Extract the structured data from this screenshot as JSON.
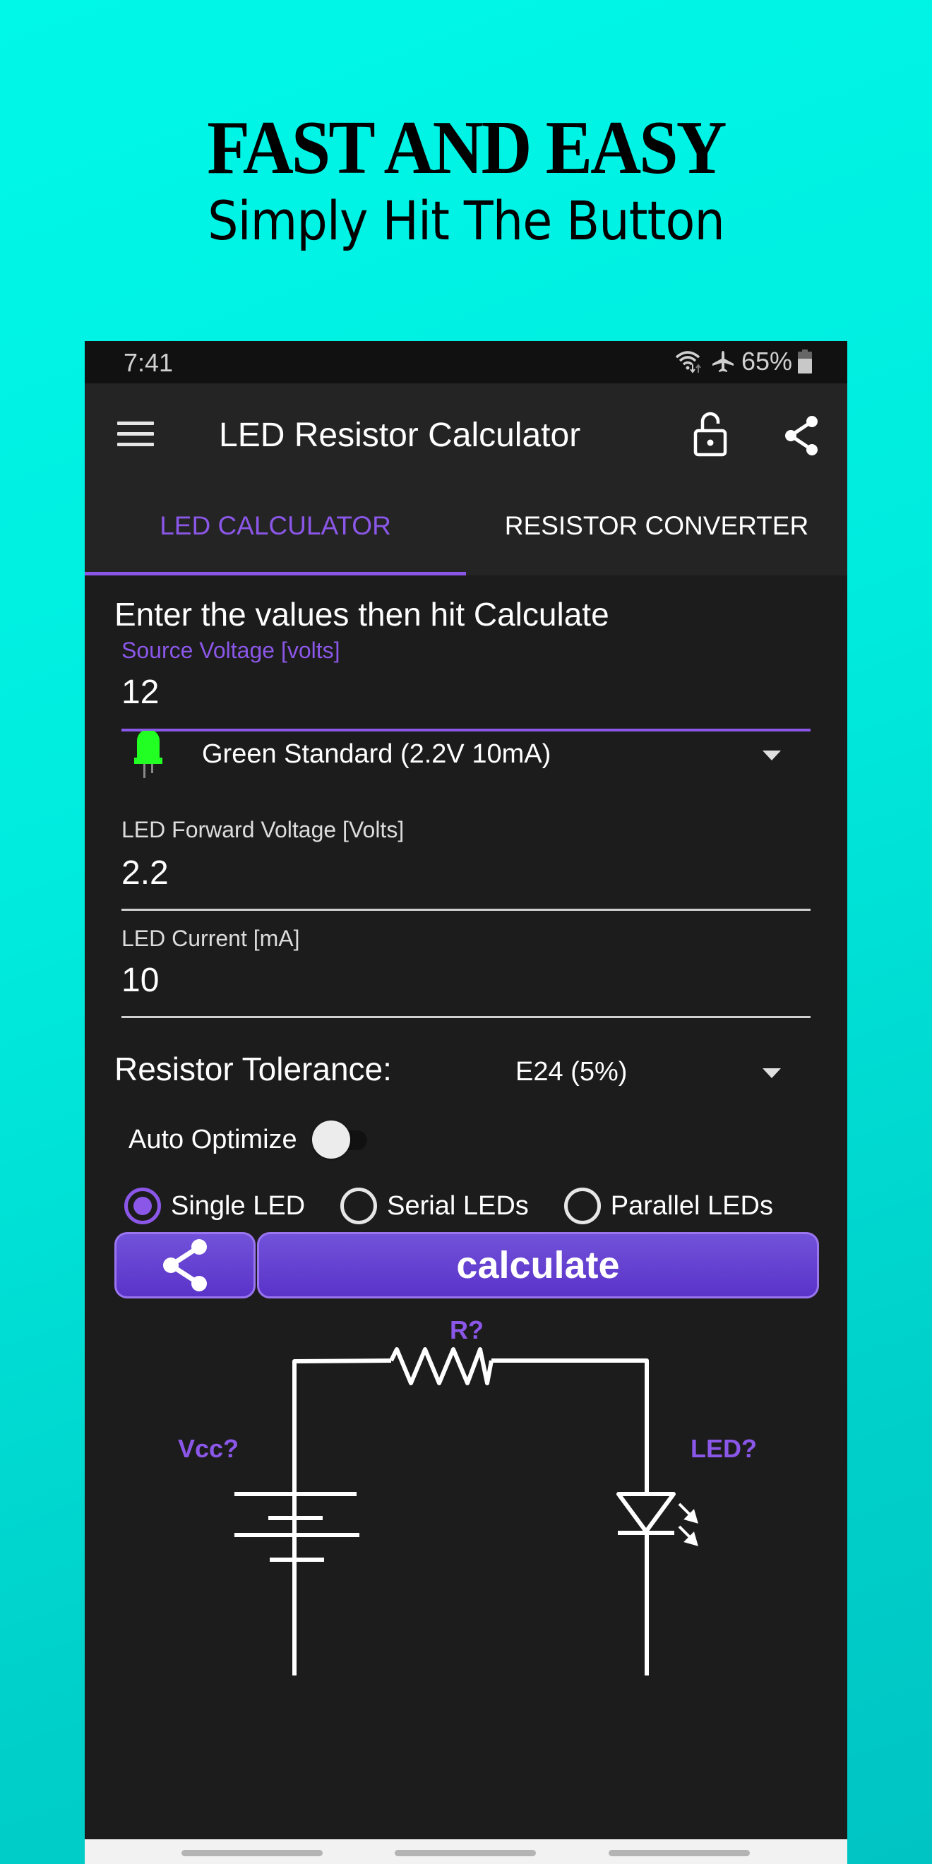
{
  "promo": {
    "title": "FAST AND EASY",
    "subtitle": "Simply Hit The Button"
  },
  "status_bar": {
    "time": "7:41",
    "battery_percent": "65%",
    "icons": [
      "wifi-icon",
      "airplane-icon",
      "battery-icon"
    ]
  },
  "toolbar": {
    "title": "LED Resistor Calculator",
    "icons": [
      "menu-icon",
      "lock-open-icon",
      "share-icon"
    ]
  },
  "tabs": [
    {
      "label": "LED CALCULATOR",
      "active": true
    },
    {
      "label": "RESISTOR CONVERTER",
      "active": false
    }
  ],
  "form": {
    "instructions": "Enter the values then hit Calculate",
    "source_voltage": {
      "label": "Source Voltage [volts]",
      "value": "12"
    },
    "led_type": {
      "selected": "Green Standard (2.2V 10mA)",
      "led_color": "#22ff22"
    },
    "forward_voltage": {
      "label": "LED Forward Voltage [Volts]",
      "value": "2.2"
    },
    "led_current": {
      "label": "LED Current [mA]",
      "value": "10"
    },
    "tolerance": {
      "label": "Resistor Tolerance:",
      "selected": "E24 (5%)"
    },
    "auto_optimize": {
      "label": "Auto Optimize",
      "on": false
    },
    "led_mode": {
      "options": [
        "Single LED",
        "Serial LEDs",
        "Parallel LEDs"
      ],
      "selected": "Single LED"
    }
  },
  "actions": {
    "calculate_label": "calculate",
    "share_icon": "share-icon"
  },
  "circuit": {
    "resistor_label": "R?",
    "source_label": "Vcc?",
    "led_label": "LED?"
  },
  "colors": {
    "accent": "#8b57e8",
    "button": "#6441d2",
    "background_app": "#1c1c1c",
    "toolbar": "#242424"
  }
}
